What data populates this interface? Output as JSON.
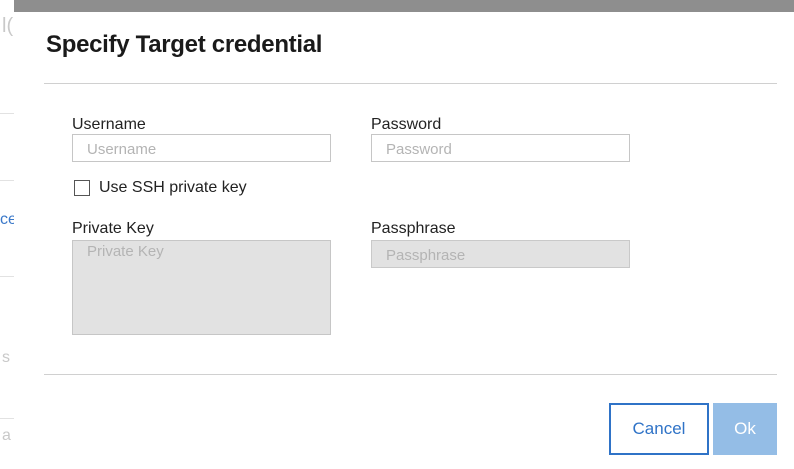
{
  "dialog": {
    "title": "Specify Target credential"
  },
  "form": {
    "username": {
      "label": "Username",
      "placeholder": "Username",
      "value": ""
    },
    "password": {
      "label": "Password",
      "placeholder": "Password",
      "value": ""
    },
    "use_ssh_key": {
      "label": "Use SSH private key",
      "checked": false
    },
    "private_key": {
      "label": "Private Key",
      "placeholder": "Private Key",
      "value": ""
    },
    "passphrase": {
      "label": "Passphrase",
      "placeholder": "Passphrase",
      "value": ""
    }
  },
  "buttons": {
    "cancel_label": "Cancel",
    "ok_label": "Ok"
  },
  "background_fragments": {
    "top_char": "l(",
    "link_fragment": "ce",
    "mid_char": "s",
    "bottom_char": "a"
  },
  "colors": {
    "primary": "#2f73c7",
    "primary_disabled": "#94bde6",
    "disabled_field": "#e2e2e2",
    "overlay": "#8e8e8e"
  }
}
